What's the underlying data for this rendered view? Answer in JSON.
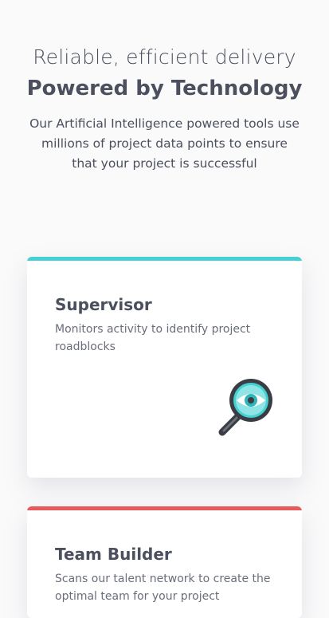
{
  "hero": {
    "subtitle": "Reliable, efficient delivery",
    "title": "Powered by Technology",
    "description": "Our Artificial Intelligence powered tools use millions of project data points to ensure that your project is successful"
  },
  "cards": [
    {
      "title": "Supervisor",
      "description": "Monitors activity to identify project roadblocks",
      "accent_color": "#45d1d3",
      "icon": "magnifier-eye-icon"
    },
    {
      "title": "Team Builder",
      "description": "Scans our talent network to create the optimal team for your project",
      "accent_color": "#e85a5a"
    }
  ]
}
